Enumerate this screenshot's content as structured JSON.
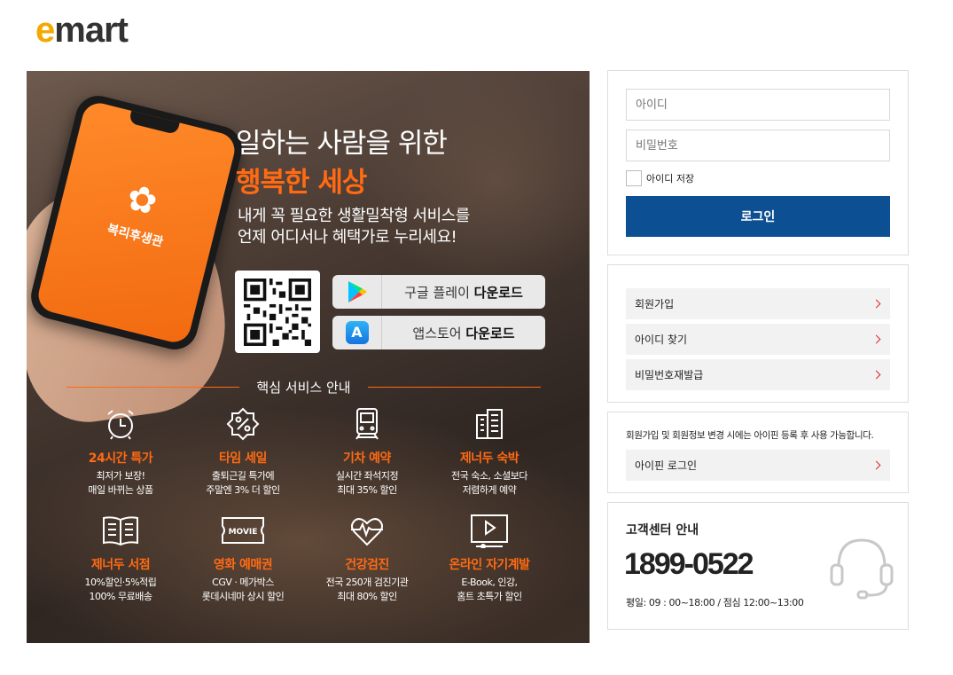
{
  "logo": {
    "e": "e",
    "rest": "mart"
  },
  "banner": {
    "headline1": "일하는 사람을 위한",
    "headline2": "행복한 세상",
    "subcopy1": "내게 꼭 필요한 생활밀착형 서비스를",
    "subcopy2": "언제 어디서나 혜택가로 누리세요!",
    "phone_app_name": "복리후생관",
    "google_btn": {
      "pre": "구글 플레이 ",
      "bold": "다운로드"
    },
    "apple_btn": {
      "pre": "앱스토어 ",
      "bold": "다운로드"
    },
    "section_title": "핵심 서비스 안내",
    "services": [
      {
        "title": "24시간 특가",
        "line1": "최저가 보장!",
        "line2": "매일 바뀌는 상품",
        "icon": "alarm-clock-icon"
      },
      {
        "title": "타임 세일",
        "line1": "출퇴근길 특가에",
        "line2": "주말엔 3% 더 할인",
        "icon": "percent-badge-icon"
      },
      {
        "title": "기차 예약",
        "line1": "실시간 좌석지정",
        "line2": "최대 35% 할인",
        "icon": "train-icon"
      },
      {
        "title": "제너두 숙박",
        "line1": "전국 숙소, 소셜보다",
        "line2": "저렴하게 예약",
        "icon": "building-icon"
      },
      {
        "title": "제너두 서점",
        "line1": "10%할인·5%적립",
        "line2": "100% 무료배송",
        "icon": "book-icon"
      },
      {
        "title": "영화 예매권",
        "line1": "CGV · 메가박스",
        "line2": "롯데시네마 상시 할인",
        "icon": "movie-ticket-icon",
        "ticket_text": "MOVIE"
      },
      {
        "title": "건강검진",
        "line1": "전국 250개 검진기관",
        "line2": "최대 80% 할인",
        "icon": "heart-pulse-icon"
      },
      {
        "title": "온라인 자기계발",
        "line1": "E-Book, 인강,",
        "line2": "홈트 초특가 할인",
        "icon": "video-play-icon"
      }
    ]
  },
  "login": {
    "id_placeholder": "아이디",
    "pw_placeholder": "비밀번호",
    "save_id_label": "아이디 저장",
    "login_button": "로그인"
  },
  "links": {
    "signup": "회원가입",
    "find_id": "아이디 찾기",
    "reset_pw": "비밀번호재발급"
  },
  "ipin": {
    "note": "회원가입 및 회원정보 변경 시에는 아이핀 등록 후 사용 가능합니다.",
    "login": "아이핀 로그인"
  },
  "customer_center": {
    "title": "고객센터 안내",
    "phone": "1899-0522",
    "hours": "평일: 09 : 00~18:00 / 점심 12:00~13:00"
  },
  "colors": {
    "brand_orange": "#ff6a13",
    "login_blue": "#0d4f93",
    "chevron_red": "#e0262b",
    "logo_yellow": "#f2a900"
  }
}
